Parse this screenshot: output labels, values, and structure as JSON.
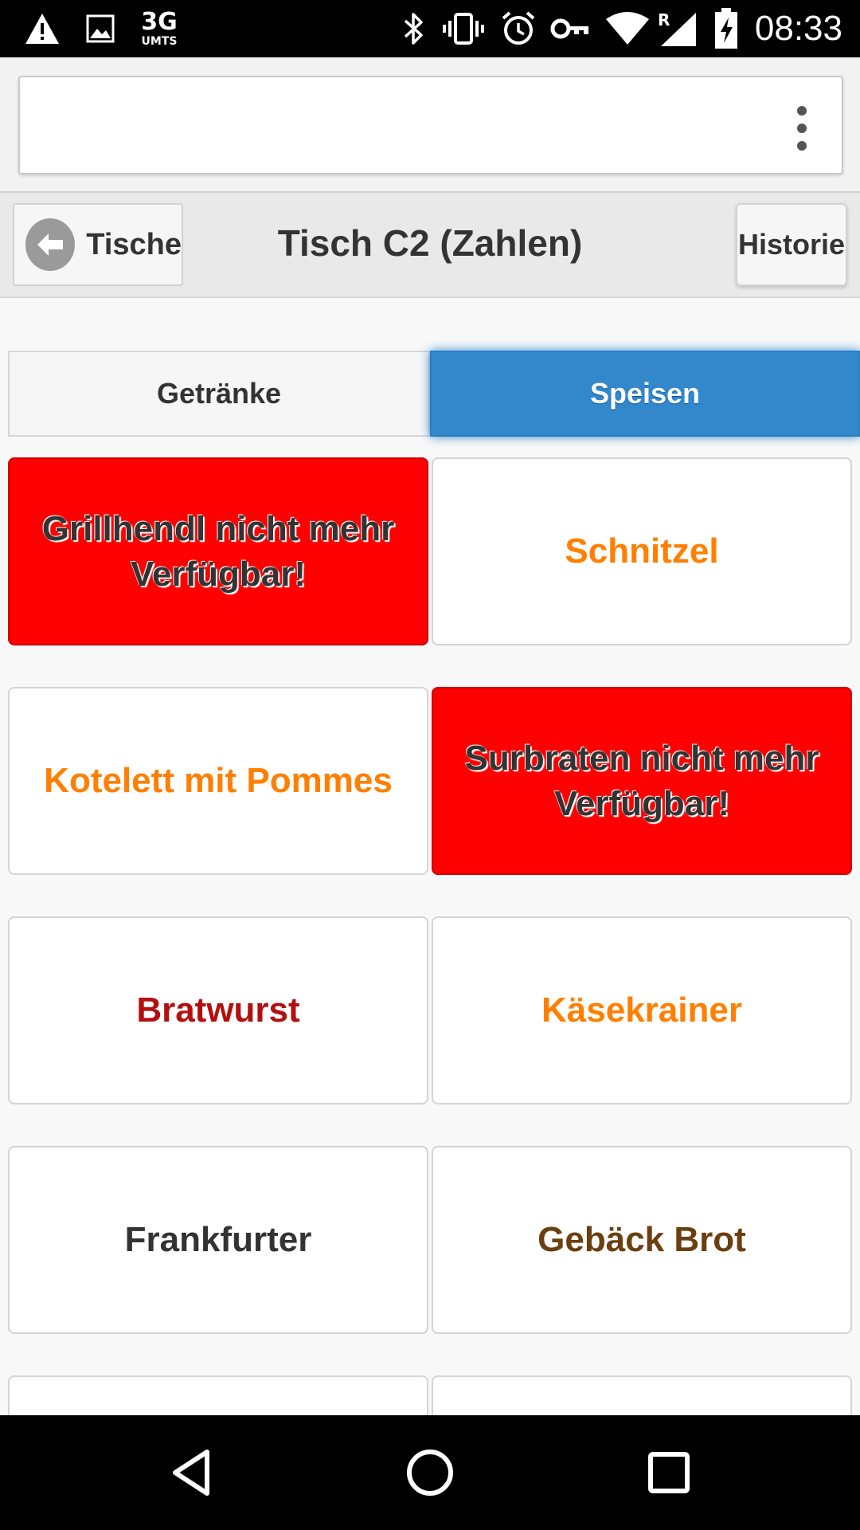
{
  "status_bar": {
    "network_type": "3G",
    "network_subtype": "UMTS",
    "roaming_indicator": "R",
    "time": "08:33",
    "icons": [
      "warning-icon",
      "image-icon",
      "bluetooth-icon",
      "vibrate-icon",
      "alarm-icon",
      "vpn-key-icon",
      "wifi-icon",
      "signal-icon",
      "battery-charging-icon"
    ]
  },
  "browser": {
    "url": "",
    "menu_icon": "more-vert-icon"
  },
  "header": {
    "back_label": "Tische",
    "back_icon": "arrow-left-icon",
    "title": "Tisch C2 (Zahlen)",
    "history_label": "Historie"
  },
  "tabs": [
    {
      "label": "Getränke",
      "active": false
    },
    {
      "label": "Speisen",
      "active": true
    }
  ],
  "items": [
    {
      "label": "Grillhendl nicht mehr Verfügbar!",
      "state": "unavailable",
      "color": "#333333"
    },
    {
      "label": "Schnitzel",
      "state": "available",
      "color": "#ff7f00"
    },
    {
      "label": "Kotelett mit Pommes",
      "state": "available",
      "color": "#ff7f00"
    },
    {
      "label": "Surbraten nicht mehr Verfügbar!",
      "state": "unavailable",
      "color": "#333333"
    },
    {
      "label": "Bratwurst",
      "state": "available",
      "color": "#b30f0f"
    },
    {
      "label": "Käsekrainer",
      "state": "available",
      "color": "#ff7f00"
    },
    {
      "label": "Frankfurter",
      "state": "available",
      "color": "#333333"
    },
    {
      "label": "Gebäck Brot",
      "state": "available",
      "color": "#6b3f10"
    },
    {
      "label": "",
      "state": "partial",
      "color": "#333333"
    },
    {
      "label": "",
      "state": "partial",
      "color": "#333333"
    }
  ],
  "colors": {
    "accent": "#3388cc",
    "unavailable": "#ff0000"
  },
  "nav_bar": {
    "icons": [
      "back-triangle-icon",
      "home-circle-icon",
      "recents-square-icon"
    ]
  }
}
